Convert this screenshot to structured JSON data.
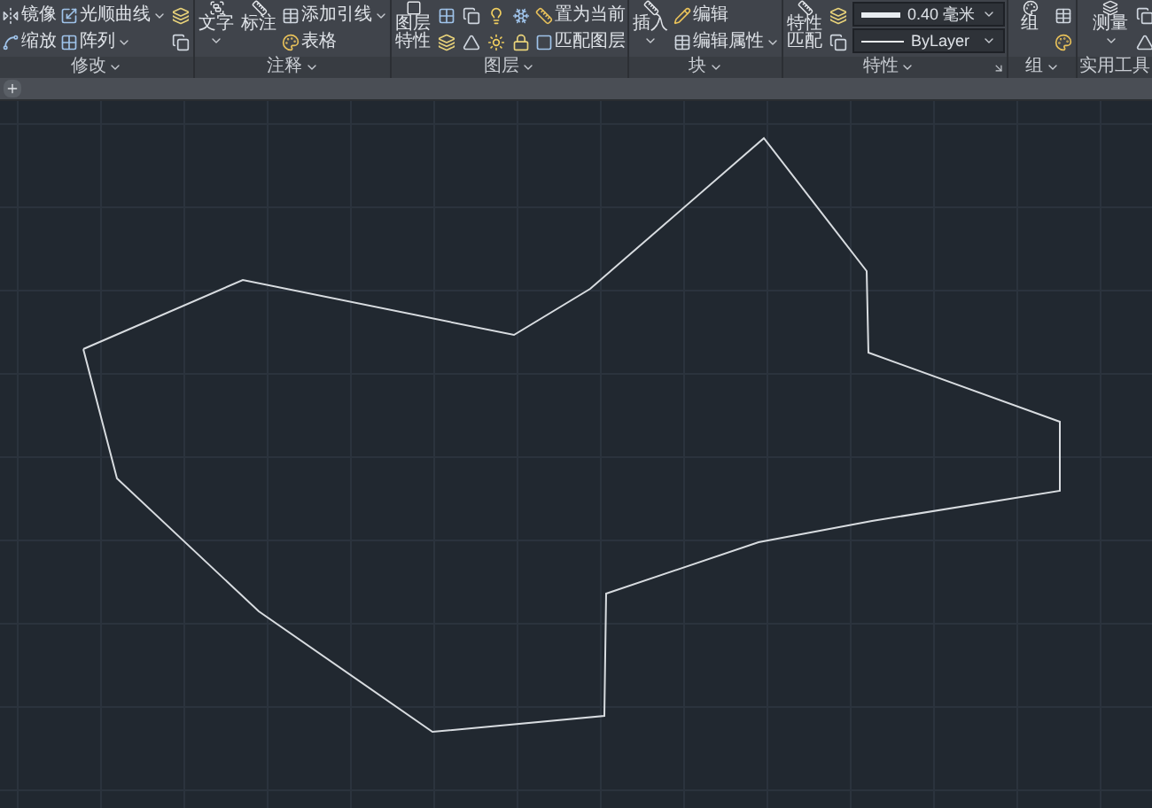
{
  "ribbon": {
    "panels": [
      {
        "title": "修改",
        "launcher": false,
        "columns": [
          {
            "kind": "stack",
            "items": [
              {
                "kind": "button",
                "label": "镜像",
                "dropdown": false
              },
              {
                "kind": "button",
                "label": "缩放",
                "dropdown": false
              }
            ]
          },
          {
            "kind": "stack",
            "items": [
              {
                "kind": "button",
                "label": "光顺曲线",
                "dropdown": true
              },
              {
                "kind": "button",
                "label": "阵列",
                "dropdown": true
              }
            ]
          },
          {
            "kind": "stack",
            "items": [
              {
                "kind": "icon"
              },
              {
                "kind": "icon"
              }
            ]
          }
        ]
      },
      {
        "title": "注释",
        "launcher": false,
        "columns": [
          {
            "kind": "large",
            "label": "文字",
            "dropdown": true
          },
          {
            "kind": "large",
            "label": "标注",
            "dropdown": false
          },
          {
            "kind": "stack",
            "items": [
              {
                "kind": "button",
                "label": "添加引线",
                "dropdown": true
              },
              {
                "kind": "button",
                "label": "表格",
                "dropdown": false
              }
            ]
          }
        ]
      },
      {
        "title": "图层",
        "launcher": false,
        "columns": [
          {
            "kind": "large",
            "label": "图层特性",
            "dropdown": false
          },
          {
            "kind": "stack",
            "items": [
              {
                "kind": "icon"
              },
              {
                "kind": "icon"
              }
            ]
          },
          {
            "kind": "stack",
            "items": [
              {
                "kind": "icon"
              },
              {
                "kind": "icon"
              }
            ]
          },
          {
            "kind": "stack",
            "items": [
              {
                "kind": "icon"
              },
              {
                "kind": "icon"
              }
            ]
          },
          {
            "kind": "stack",
            "items": [
              {
                "kind": "icon"
              },
              {
                "kind": "icon"
              }
            ]
          },
          {
            "kind": "stack",
            "items": [
              {
                "kind": "button",
                "label": "置为当前",
                "dropdown": false
              },
              {
                "kind": "button",
                "label": "匹配图层",
                "dropdown": false
              }
            ]
          }
        ]
      },
      {
        "title": "块",
        "launcher": false,
        "columns": [
          {
            "kind": "large",
            "label": "插入",
            "dropdown": true
          },
          {
            "kind": "stack",
            "items": [
              {
                "kind": "button",
                "label": "编辑",
                "dropdown": false
              },
              {
                "kind": "button",
                "label": "编辑属性",
                "dropdown": true
              }
            ]
          }
        ]
      },
      {
        "title": "特性",
        "launcher": true,
        "columns": [
          {
            "kind": "large",
            "label": "特性匹配",
            "dropdown": false
          },
          {
            "kind": "stack",
            "items": [
              {
                "kind": "icon"
              },
              {
                "kind": "icon"
              }
            ]
          },
          {
            "kind": "stack",
            "items": [
              {
                "kind": "lineweight-select",
                "value": "0.40 毫米"
              },
              {
                "kind": "linetype-select",
                "value": "ByLayer"
              }
            ]
          }
        ]
      },
      {
        "title": "组",
        "launcher": false,
        "columns": [
          {
            "kind": "large",
            "label": "组",
            "dropdown": false
          },
          {
            "kind": "stack",
            "items": [
              {
                "kind": "icon"
              },
              {
                "kind": "icon"
              }
            ]
          }
        ]
      },
      {
        "title": "实用工具",
        "launcher": false,
        "columns": [
          {
            "kind": "large",
            "label": "测量",
            "dropdown": true
          },
          {
            "kind": "stack",
            "items": [
              {
                "kind": "icon"
              },
              {
                "kind": "icon"
              }
            ]
          }
        ]
      }
    ]
  }
}
